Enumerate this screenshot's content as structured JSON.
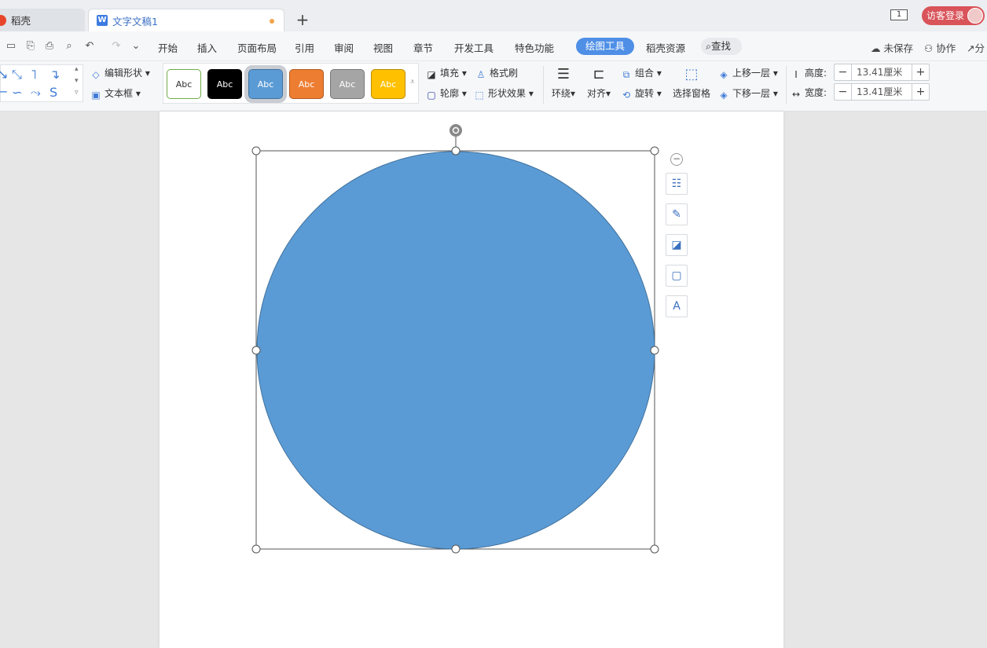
{
  "tabs": {
    "docer_label": "稻壳",
    "doc_label": "文字文稿1",
    "new_tab_glyph": "+"
  },
  "header_right": {
    "window_count": "1",
    "login_label": "访客登录"
  },
  "menu": {
    "items": [
      "开始",
      "插入",
      "页面布局",
      "引用",
      "审阅",
      "视图",
      "章节",
      "开发工具",
      "特色功能"
    ],
    "active": "绘图工具",
    "resources": "稻壳资源",
    "search": "查找",
    "unsaved": "未保存",
    "collab": "协作",
    "share": "分"
  },
  "ribbon": {
    "edit_shape": "编辑形状",
    "text_box": "文本框",
    "styles": [
      {
        "label": "Abc",
        "bg": "#ffffff",
        "fg": "#333333",
        "border": "#70ad47"
      },
      {
        "label": "Abc",
        "bg": "#000000",
        "fg": "#ffffff",
        "border": "#000000"
      },
      {
        "label": "Abc",
        "bg": "#5b9bd5",
        "fg": "#ffffff",
        "border": "#41719c"
      },
      {
        "label": "Abc",
        "bg": "#ed7d31",
        "fg": "#ffffff",
        "border": "#ae5a21"
      },
      {
        "label": "Abc",
        "bg": "#a5a5a5",
        "fg": "#ffffff",
        "border": "#787878"
      },
      {
        "label": "Abc",
        "bg": "#ffc000",
        "fg": "#ffffff",
        "border": "#bc8c00"
      }
    ],
    "fill": "填充",
    "format_painter": "格式刷",
    "outline": "轮廓",
    "shape_effects": "形状效果",
    "wrap": "环绕",
    "align": "对齐",
    "group": "组合",
    "rotate": "旋转",
    "selection_pane": "选择窗格",
    "bring_forward": "上移一层",
    "send_backward": "下移一层",
    "height_label": "高度:",
    "height_value": "13.41厘米",
    "width_label": "宽度:",
    "width_value": "13.41厘米"
  },
  "shape": {
    "fill_color": "#5b9bd5",
    "stroke_color": "#41719c"
  },
  "icons": {
    "side_tools": [
      "layout-options-icon",
      "brush-icon",
      "fill-icon",
      "outline-icon",
      "text-box-icon"
    ]
  }
}
